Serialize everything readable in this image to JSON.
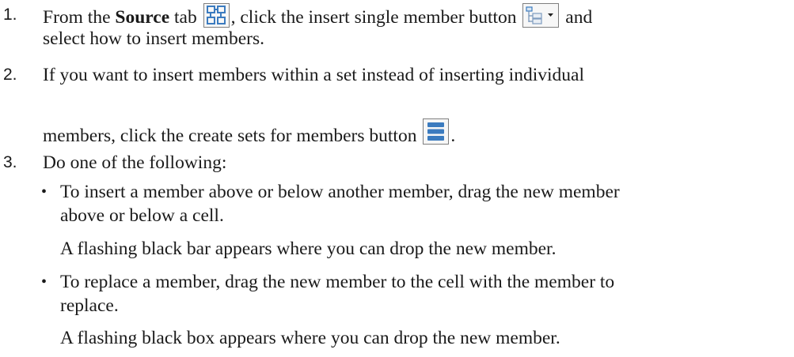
{
  "steps": [
    {
      "number": "1.",
      "part_a": "From the ",
      "bold": "Source",
      "part_b": " tab",
      "part_c": ", click the insert single member button",
      "part_d": "and",
      "line2": "select how to insert members."
    },
    {
      "number": "2.",
      "line1": "If you want to insert members within a set instead of inserting individual",
      "line2": "members, click the create sets for members button",
      "line2_end": "."
    },
    {
      "number": "3.",
      "line1": "Do one of the following:"
    }
  ],
  "bullets": [
    {
      "marker": "•",
      "line1": "To insert a member above or below another member, drag the new member",
      "line2": "above or below a cell.",
      "note": "A flashing black bar appears where you can drop the new member."
    },
    {
      "marker": "•",
      "line1": "To replace a member, drag the new member to the cell with the member to",
      "line2": "replace.",
      "note": "A flashing black box appears where you can drop the new member."
    }
  ],
  "icons": {
    "source_tab": "source-tab-icon",
    "insert_member": "insert-single-member-icon",
    "create_sets": "create-sets-icon"
  },
  "colors": {
    "icon_blue": "#3b7bbf",
    "icon_border": "#7f7f7f",
    "text": "#1a1a1a"
  }
}
